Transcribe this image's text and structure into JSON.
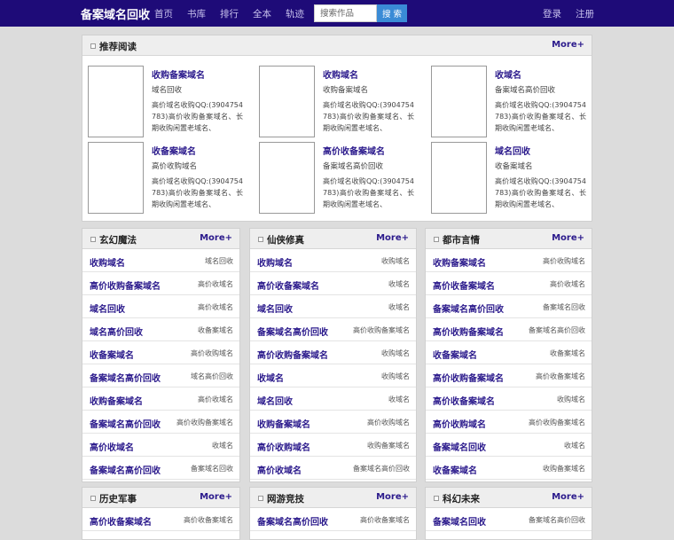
{
  "header": {
    "brand": "备案域名回收",
    "nav": [
      "首页",
      "书库",
      "排行",
      "全本",
      "轨迹"
    ],
    "search_placeholder": "搜索作品",
    "search_button": "搜 索",
    "login": "登录",
    "register": "注册"
  },
  "recommend": {
    "title": "推荐阅读",
    "more": "More+",
    "items": [
      {
        "title": "收购备案域名",
        "author": "域名回收",
        "desc": "高价域名收购QQ:(3904754783)高价收购备案域名、长期收购闲置老域名、"
      },
      {
        "title": "收购域名",
        "author": "收购备案域名",
        "desc": "高价域名收购QQ:(3904754783)高价收购备案域名、长期收购闲置老域名、"
      },
      {
        "title": "收域名",
        "author": "备案域名高价回收",
        "desc": "高价域名收购QQ:(3904754783)高价收购备案域名、长期收购闲置老域名、"
      },
      {
        "title": "收备案域名",
        "author": "高价收购域名",
        "desc": "高价域名收购QQ:(3904754783)高价收购备案域名、长期收购闲置老域名、"
      },
      {
        "title": "高价收备案域名",
        "author": "备案域名高价回收",
        "desc": "高价域名收购QQ:(3904754783)高价收购备案域名、长期收购闲置老域名、"
      },
      {
        "title": "域名回收",
        "author": "收备案域名",
        "desc": "高价域名收购QQ:(3904754783)高价收购备案域名、长期收购闲置老域名、"
      }
    ]
  },
  "categories": [
    {
      "title": "玄幻魔法",
      "more": "More+",
      "rows": [
        {
          "title": "收购域名",
          "meta": "域名回收"
        },
        {
          "title": "高价收购备案域名",
          "meta": "高价收域名"
        },
        {
          "title": "域名回收",
          "meta": "高价收域名"
        },
        {
          "title": "域名高价回收",
          "meta": "收备案域名"
        },
        {
          "title": "收备案域名",
          "meta": "高价收购域名"
        },
        {
          "title": "备案域名高价回收",
          "meta": "域名高价回收"
        },
        {
          "title": "收购备案域名",
          "meta": "高价收域名"
        },
        {
          "title": "备案域名高价回收",
          "meta": "高价收购备案域名"
        },
        {
          "title": "高价收域名",
          "meta": "收域名"
        },
        {
          "title": "备案域名高价回收",
          "meta": "备案域名回收"
        }
      ]
    },
    {
      "title": "仙侠修真",
      "more": "More+",
      "rows": [
        {
          "title": "收购域名",
          "meta": "收购域名"
        },
        {
          "title": "高价收备案域名",
          "meta": "收域名"
        },
        {
          "title": "域名回收",
          "meta": "收域名"
        },
        {
          "title": "备案域名高价回收",
          "meta": "高价收购备案域名"
        },
        {
          "title": "高价收购备案域名",
          "meta": "收购域名"
        },
        {
          "title": "收域名",
          "meta": "收购域名"
        },
        {
          "title": "域名回收",
          "meta": "收域名"
        },
        {
          "title": "收购备案域名",
          "meta": "高价收购域名"
        },
        {
          "title": "高价收购域名",
          "meta": "收购备案域名"
        },
        {
          "title": "高价收域名",
          "meta": "备案域名高价回收"
        }
      ]
    },
    {
      "title": "都市言情",
      "more": "More+",
      "rows": [
        {
          "title": "收购备案域名",
          "meta": "高价收购域名"
        },
        {
          "title": "高价收备案域名",
          "meta": "高价收域名"
        },
        {
          "title": "备案域名高价回收",
          "meta": "备案域名回收"
        },
        {
          "title": "高价收购备案域名",
          "meta": "备案域名高价回收"
        },
        {
          "title": "收备案域名",
          "meta": "收备案域名"
        },
        {
          "title": "高价收购备案域名",
          "meta": "高价收备案域名"
        },
        {
          "title": "高价收备案域名",
          "meta": "收购域名"
        },
        {
          "title": "高价收购域名",
          "meta": "高价收购备案域名"
        },
        {
          "title": "备案域名回收",
          "meta": "收域名"
        },
        {
          "title": "收备案域名",
          "meta": "收购备案域名"
        }
      ]
    },
    {
      "title": "历史军事",
      "more": "More+",
      "rows": [
        {
          "title": "高价收备案域名",
          "meta": "高价收备案域名"
        }
      ]
    },
    {
      "title": "网游竞技",
      "more": "More+",
      "rows": [
        {
          "title": "备案域名高价回收",
          "meta": "高价收备案域名"
        }
      ]
    },
    {
      "title": "科幻未来",
      "more": "More+",
      "rows": [
        {
          "title": "备案域名回收",
          "meta": "备案域名高价回收"
        }
      ]
    }
  ]
}
